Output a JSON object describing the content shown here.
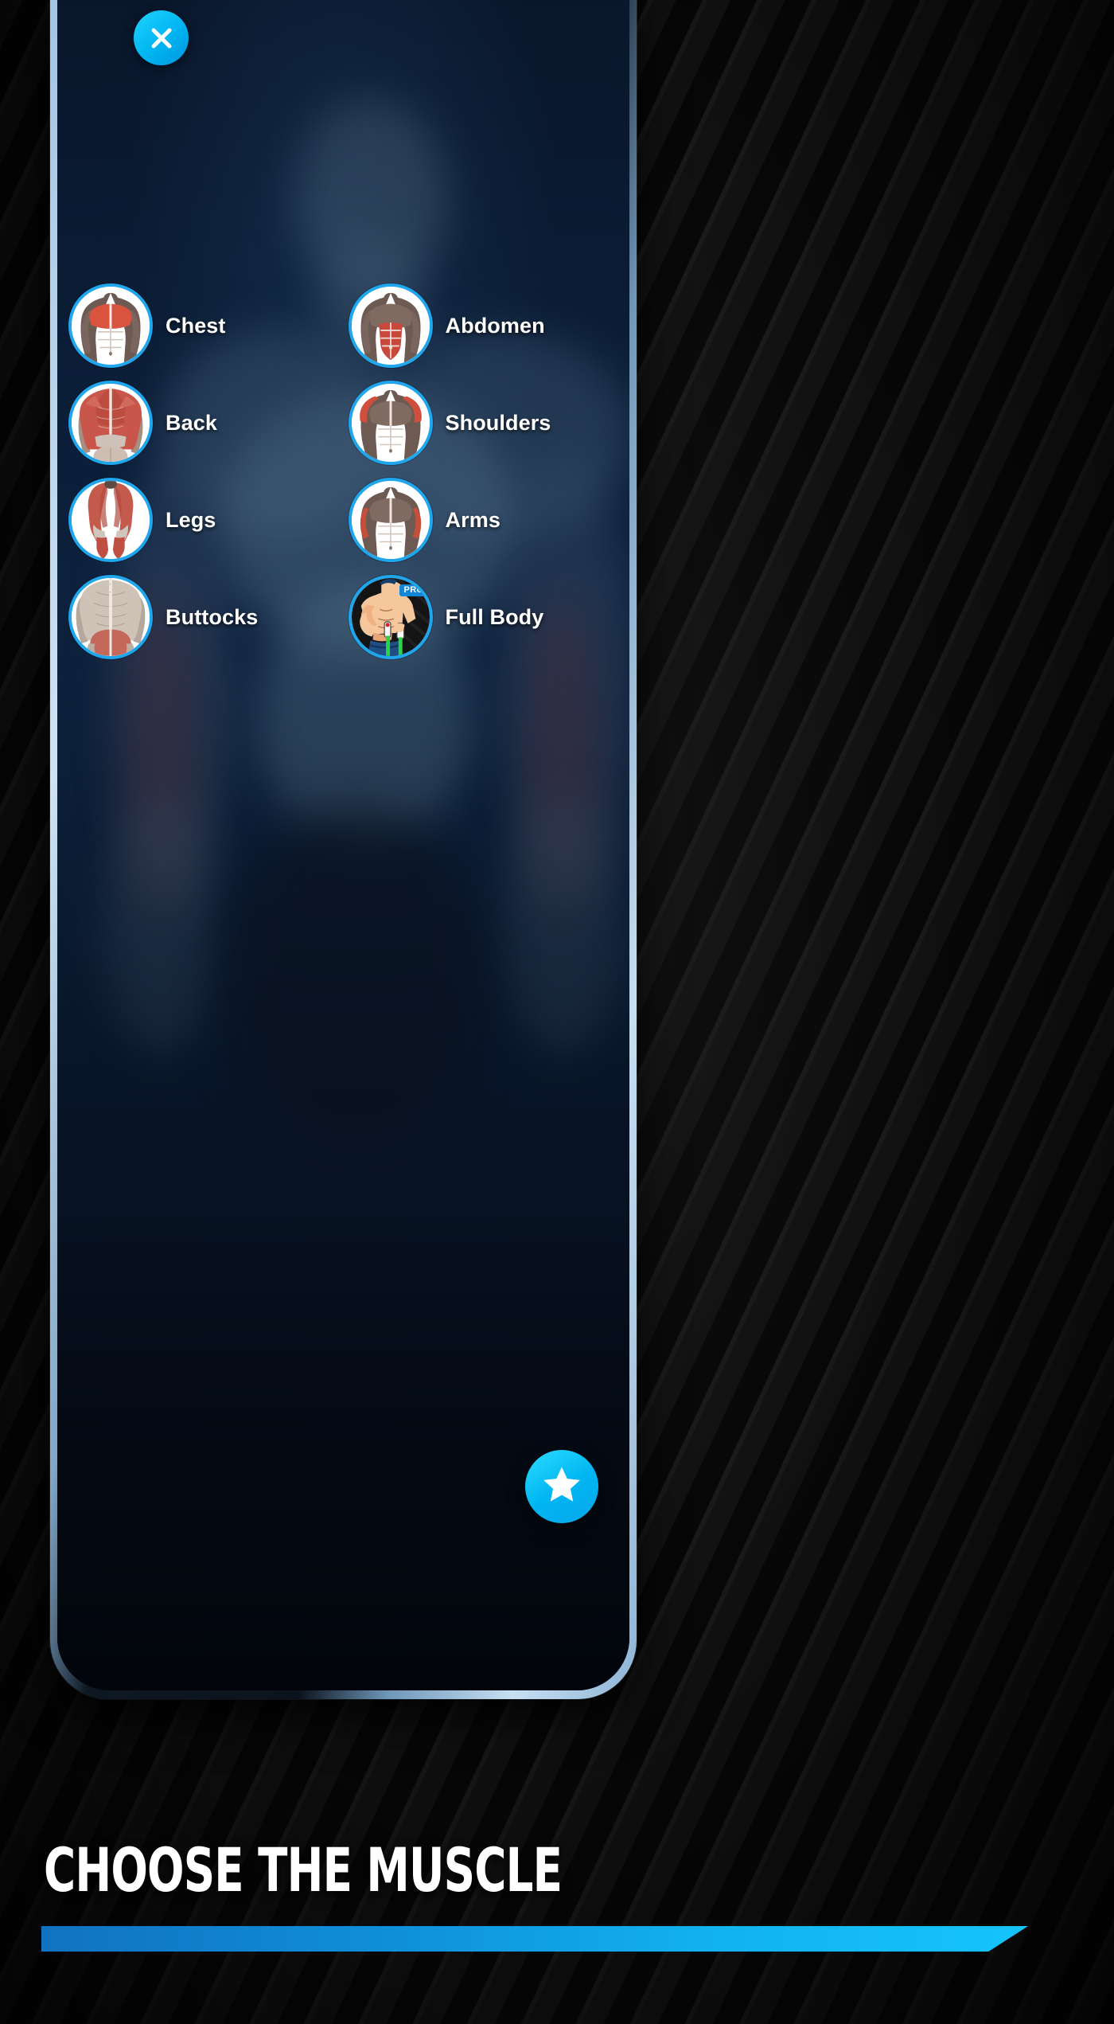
{
  "app": {
    "screen_title": "Choose the muscle"
  },
  "header": {
    "close_icon": "close-x-icon",
    "close_label": "Close"
  },
  "muscle_groups": [
    {
      "label": "Chest",
      "icon": "chest-anatomy-icon",
      "highlight_color": "#d9533f",
      "pro": false,
      "column": 1,
      "row": 1
    },
    {
      "label": "Abdomen",
      "icon": "abdomen-anatomy-icon",
      "highlight_color": "#c9483c",
      "pro": false,
      "column": 2,
      "row": 1
    },
    {
      "label": "Back",
      "icon": "back-anatomy-icon",
      "highlight_color": "#c9564a",
      "pro": false,
      "column": 1,
      "row": 2
    },
    {
      "label": "Shoulders",
      "icon": "shoulders-anatomy-icon",
      "highlight_color": "#cf4f3c",
      "pro": false,
      "column": 2,
      "row": 2
    },
    {
      "label": "Legs",
      "icon": "legs-anatomy-icon",
      "highlight_color": "#c45a4c",
      "pro": false,
      "column": 1,
      "row": 3
    },
    {
      "label": "Arms",
      "icon": "arms-anatomy-icon",
      "highlight_color": "#c4503c",
      "pro": false,
      "column": 2,
      "row": 3
    },
    {
      "label": "Buttocks",
      "icon": "buttocks-anatomy-icon",
      "highlight_color": "#c4685c",
      "pro": false,
      "column": 1,
      "row": 4
    },
    {
      "label": "Full Body",
      "icon": "full-body-cartoon-icon",
      "highlight_color": "#f0b183",
      "pro": true,
      "column": 2,
      "row": 4
    }
  ],
  "pro_badge": {
    "label": "PRO",
    "color": "#1186d8"
  },
  "favorites_fab": {
    "icon": "star-icon",
    "label": "Favorites"
  },
  "caption": {
    "title": "CHOOSE THE MUSCLE",
    "accent_color": "#12b4f0"
  },
  "theme": {
    "accent": "#1fa6ec",
    "accent_bright": "#00b6f2",
    "screen_bg": "#0b1a30",
    "promo_bg": "#0a0a0a",
    "text": "#ffffff"
  }
}
